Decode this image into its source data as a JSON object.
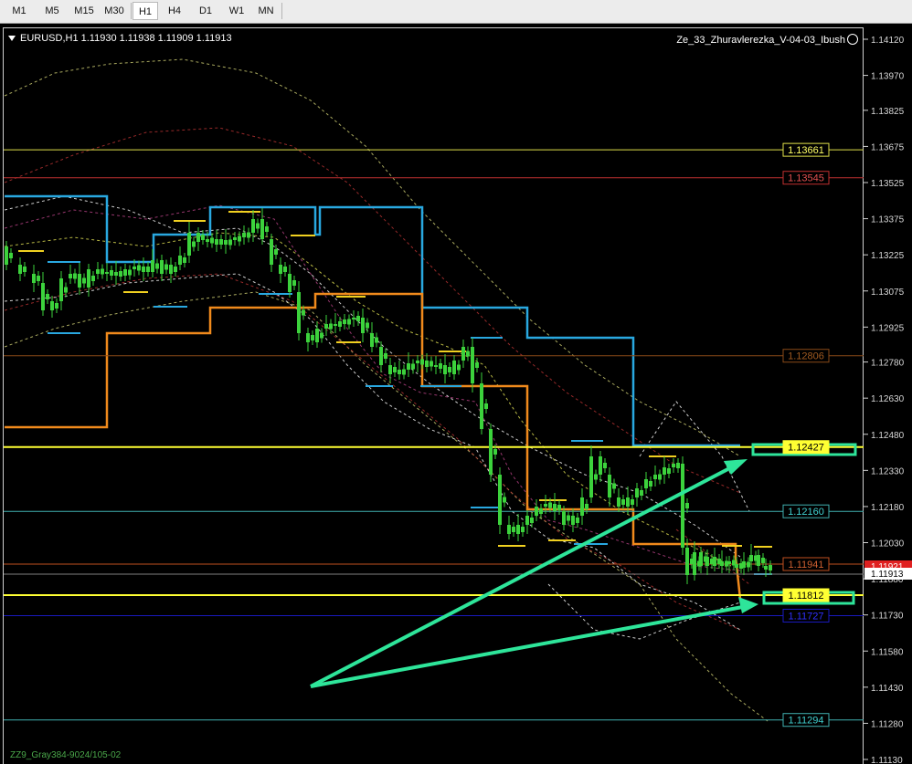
{
  "toolbar": {
    "timeframes": [
      "M1",
      "M5",
      "M15",
      "M30",
      "H1",
      "H4",
      "D1",
      "W1",
      "MN"
    ],
    "selected": "H1"
  },
  "chart": {
    "symbol_line": "EURUSD,H1  1.11930 1.11938 1.11909 1.11913",
    "indicator_label": "Ze_33_Zhuravlerezka_V-04-03_Ibush",
    "bottom_label": "ZZ9_Gray384-9024/105-02",
    "colors": {
      "background": "#000000",
      "candles": "#3cd23c",
      "blue_channel": "#29a8e0",
      "orange_channel": "#f08a1c",
      "yellow_level": "#ffff33",
      "arrows": "#2ee59a"
    }
  },
  "chart_data": {
    "type": "line",
    "symbol": "EURUSD",
    "timeframe": "H1",
    "ohlc_last": {
      "open": 1.1193,
      "high": 1.11938,
      "low": 1.11909,
      "close": 1.11913
    },
    "price_axis_ticks": [
      "1.14120",
      "1.13970",
      "1.13825",
      "1.13675",
      "1.13525",
      "1.13375",
      "1.13225",
      "1.13075",
      "1.12925",
      "1.12780",
      "1.12630",
      "1.12480",
      "1.12330",
      "1.12180",
      "1.12030",
      "1.11880",
      "1.11730",
      "1.11580",
      "1.11430",
      "1.11280",
      "1.11130"
    ],
    "current_price": "1.11913",
    "bid_tag": "1.11921",
    "horizontal_levels": [
      {
        "label": "1.13661",
        "color": "#e0e04a",
        "text_color": "#ffff66",
        "fill": "#000000"
      },
      {
        "label": "1.13545",
        "color": "#c03030",
        "text_color": "#e05050",
        "fill": "#000000"
      },
      {
        "label": "1.12806",
        "color": "#8a4a18",
        "text_color": "#a05a20",
        "fill": "#000000"
      },
      {
        "label": "1.12427",
        "color": "#ffff33",
        "text_color": "#000000",
        "fill": "#ffff33"
      },
      {
        "label": "1.12160",
        "color": "#40b0b0",
        "text_color": "#40d0d0",
        "fill": "#000000"
      },
      {
        "label": "1.11941",
        "color": "#c05020",
        "text_color": "#d06030",
        "fill": "#000000"
      },
      {
        "label": "1.11812",
        "color": "#ffff33",
        "text_color": "#000000",
        "fill": "#ffff33"
      },
      {
        "label": "1.11727",
        "color": "#1a1ac0",
        "text_color": "#3030ff",
        "fill": "#000000"
      },
      {
        "label": "1.11294",
        "color": "#40b0b0",
        "text_color": "#40d0d0",
        "fill": "#000000"
      }
    ]
  }
}
